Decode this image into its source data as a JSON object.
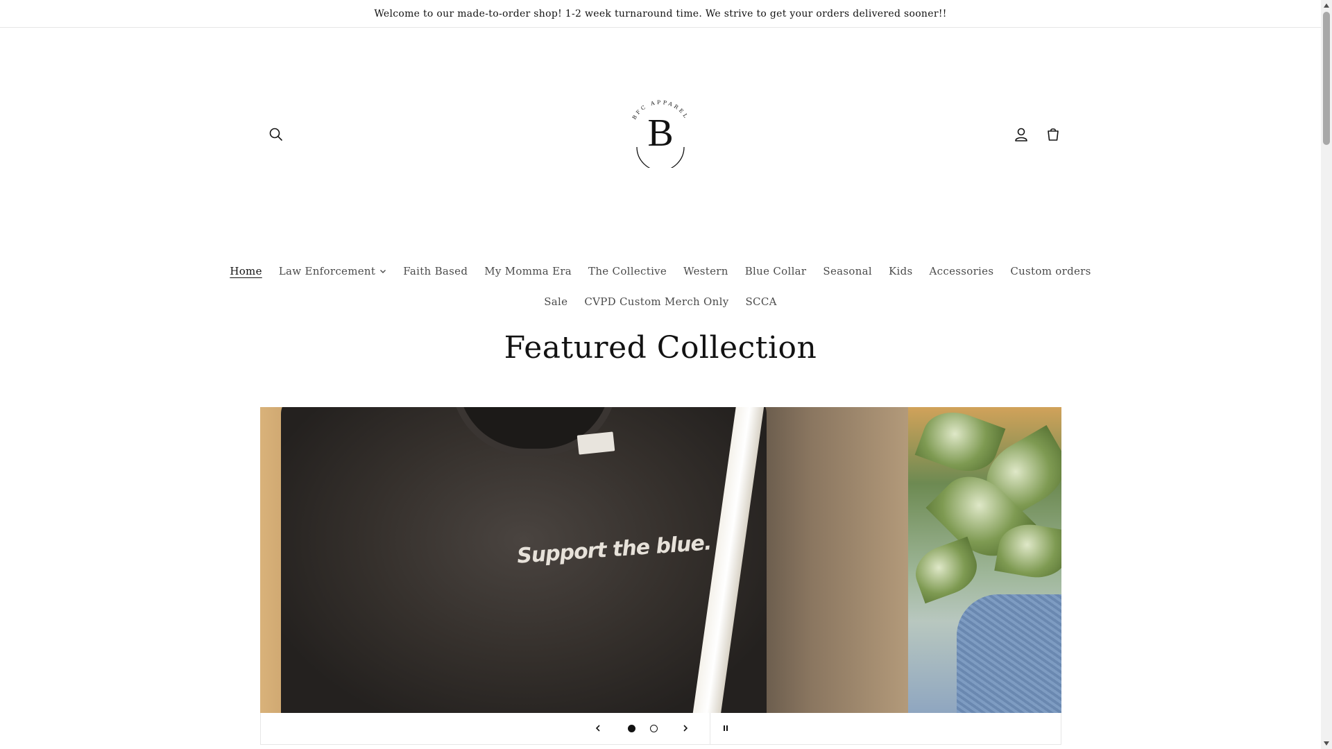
{
  "announcement": {
    "text": "Welcome to our made-to-order shop! 1-2 week turnaround time. We strive to get your orders delivered sooner!!"
  },
  "header": {
    "logo": {
      "letter": "B",
      "arc_text": "BFC APPAREL"
    },
    "icons": {
      "search": "search-icon",
      "account": "account-icon",
      "cart": "cart-icon"
    }
  },
  "nav": {
    "row1": [
      {
        "label": "Home",
        "active": true
      },
      {
        "label": "Law Enforcement",
        "has_dropdown": true
      },
      {
        "label": "Faith Based"
      },
      {
        "label": "My Momma Era"
      },
      {
        "label": "The Collective"
      },
      {
        "label": "Western"
      },
      {
        "label": "Blue Collar"
      },
      {
        "label": "Seasonal"
      },
      {
        "label": "Kids"
      },
      {
        "label": "Accessories"
      },
      {
        "label": "Custom orders"
      }
    ],
    "row2": [
      {
        "label": "Sale"
      },
      {
        "label": "CVPD Custom Merch Only"
      },
      {
        "label": "SCCA"
      }
    ]
  },
  "featured": {
    "title": "Featured Collection",
    "slide_text": "Support the blue.",
    "slides_total": 2,
    "current_slide": 1
  },
  "colors": {
    "text": "#121212",
    "nav_text": "#4a4a4a",
    "border": "#e6e6e6"
  }
}
